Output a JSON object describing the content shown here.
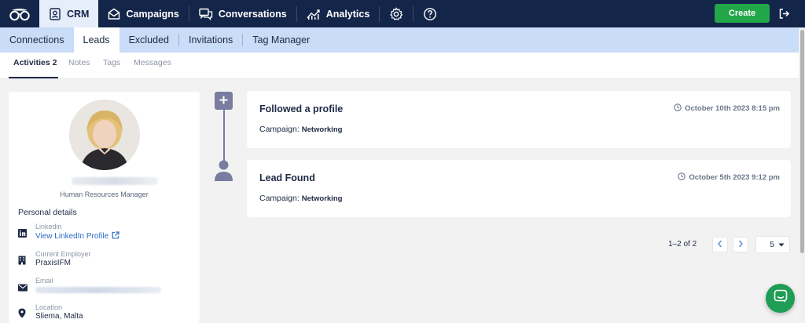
{
  "topnav": {
    "items": [
      {
        "label": "CRM",
        "icon": "contact-card-icon"
      },
      {
        "label": "Campaigns",
        "icon": "envelope-icon"
      },
      {
        "label": "Conversations",
        "icon": "chat-bubbles-icon"
      },
      {
        "label": "Analytics",
        "icon": "chart-icon"
      }
    ],
    "create_label": "Create"
  },
  "subnav": {
    "items": [
      "Connections",
      "Leads",
      "Excluded",
      "Invitations",
      "Tag Manager"
    ]
  },
  "tabs": [
    "Activities 2",
    "Notes",
    "Tags",
    "Messages"
  ],
  "profile": {
    "job_title": "Human Resources Manager",
    "section_title": "Personal details",
    "linkedin_label": "Linkedin",
    "linkedin_value": "View LinkedIn Profile",
    "employer_label": "Current Employer",
    "employer_value": "PraxisIFM",
    "email_label": "Email",
    "location_label": "Location",
    "location_value": "Sliema, Malta"
  },
  "activities": [
    {
      "title": "Followed a profile",
      "date": "October 10th 2023 8:15 pm",
      "campaign_label": "Campaign:",
      "campaign": "Networking"
    },
    {
      "title": "Lead Found",
      "date": "October 5th 2023 9:12 pm",
      "campaign_label": "Campaign:",
      "campaign": "Networking"
    }
  ],
  "pagination": {
    "count": "1–2 of 2",
    "per_page": "5"
  },
  "colors": {
    "nav": "#14254a",
    "subnav": "#c9dcf8",
    "accent_green": "#22a64a",
    "timeline": "#7a7c9f"
  }
}
